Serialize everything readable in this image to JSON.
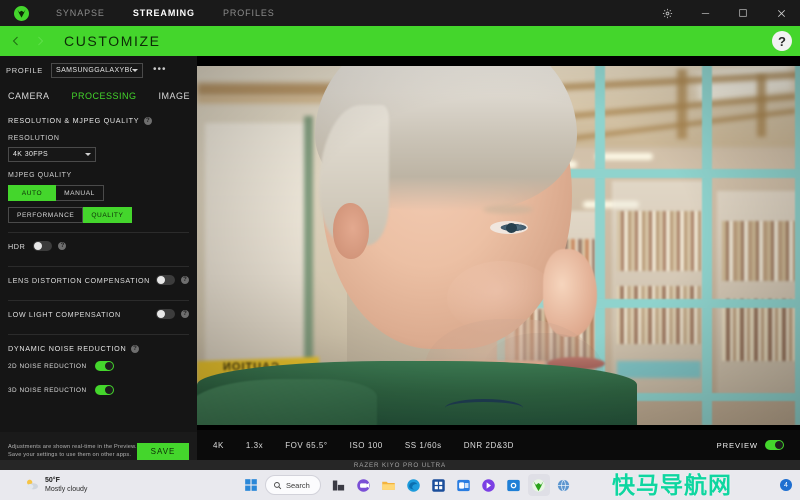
{
  "titlebar": {
    "logo_icon": "razer-logo-icon",
    "tabs": [
      {
        "label": "SYNAPSE",
        "active": false
      },
      {
        "label": "STREAMING",
        "active": true
      },
      {
        "label": "PROFILES",
        "active": false
      }
    ],
    "window_controls": [
      {
        "name": "settings-gear-icon",
        "glyph": "gear"
      },
      {
        "name": "minimize-icon",
        "glyph": "minimize"
      },
      {
        "name": "maximize-icon",
        "glyph": "maximize"
      },
      {
        "name": "close-icon",
        "glyph": "close"
      }
    ]
  },
  "header": {
    "back_icon": "chevron-left-icon",
    "forward_icon": "chevron-right-icon",
    "title": "CUSTOMIZE",
    "help_label": "?"
  },
  "sidebar": {
    "profile_label": "PROFILE",
    "profile_value": "SAMSUNGGALAXYBO...",
    "more_options": "•••",
    "subtabs": [
      {
        "label": "CAMERA",
        "active": false
      },
      {
        "label": "PROCESSING",
        "active": true
      },
      {
        "label": "IMAGE",
        "active": false
      }
    ],
    "section_resolution": {
      "title": "RESOLUTION & MJPEG QUALITY",
      "resolution_label": "RESOLUTION",
      "resolution_value": "4K 30FPS",
      "mjpeg_label": "MJPEG QUALITY",
      "mode_options": [
        {
          "label": "AUTO",
          "selected": true
        },
        {
          "label": "MANUAL",
          "selected": false
        }
      ],
      "quality_options": [
        {
          "label": "PERFORMANCE",
          "selected": false
        },
        {
          "label": "QUALITY",
          "selected": true
        }
      ]
    },
    "toggles": [
      {
        "label": "HDR",
        "on": false,
        "layout": "label-toggle-info"
      },
      {
        "label": "LENS DISTORTION COMPENSATION",
        "on": false,
        "layout": "label-spacer-toggle-info"
      },
      {
        "label": "LOW LIGHT COMPENSATION",
        "on": false,
        "layout": "label-spacer-toggle-info"
      }
    ],
    "dnr": {
      "title": "DYNAMIC NOISE REDUCTION",
      "items": [
        {
          "label": "2D NOISE REDUCTION",
          "on": true
        },
        {
          "label": "3D NOISE REDUCTION",
          "on": true
        }
      ]
    },
    "savebar": {
      "line1": "Adjustments are shown real-time in the Preview.",
      "line2": "Save your settings to use them on other apps.",
      "save_label": "SAVE"
    }
  },
  "statusbar": {
    "items": [
      "4K",
      "1.3x",
      "FOV 65.5°",
      "ISO 100",
      "SS 1/60s",
      "DNR 2D&3D"
    ],
    "preview_label": "PREVIEW",
    "preview_on": true
  },
  "devicebar": {
    "name": "RAZER KIYO PRO ULTRA"
  },
  "taskbar": {
    "weather": {
      "temp": "50°F",
      "condition": "Mostly cloudy",
      "icon": "partly-cloudy-icon"
    },
    "start_icon": "windows-start-icon",
    "search_placeholder": "Search",
    "search_icon": "search-icon",
    "apps": [
      {
        "name": "taskbar-icon-file-explorer-dark",
        "color": "#3b3b44"
      },
      {
        "name": "taskbar-icon-teams",
        "color": "#6b4fd0"
      },
      {
        "name": "taskbar-icon-file-explorer",
        "color": "#f5b33c"
      },
      {
        "name": "taskbar-icon-edge",
        "color": "#1a9bdc"
      },
      {
        "name": "taskbar-icon-store",
        "color": "#2a6ed6"
      },
      {
        "name": "taskbar-icon-outlook",
        "color": "#2a7de1"
      },
      {
        "name": "taskbar-icon-power-automate",
        "color": "#7b3fe4"
      },
      {
        "name": "taskbar-icon-camera-app",
        "color": "#1f7fd6"
      },
      {
        "name": "taskbar-icon-razer-synapse",
        "color": "#44d62c"
      },
      {
        "name": "taskbar-icon-globe",
        "color": "#4a8fd0"
      }
    ],
    "tray_badge": "4"
  },
  "watermark": {
    "text": "快马导航网",
    "color": "#0fd6a0"
  },
  "colors": {
    "razer_green": "#44d62c",
    "panel_bg": "#151515",
    "titlebar_bg": "#1a1a1a"
  }
}
